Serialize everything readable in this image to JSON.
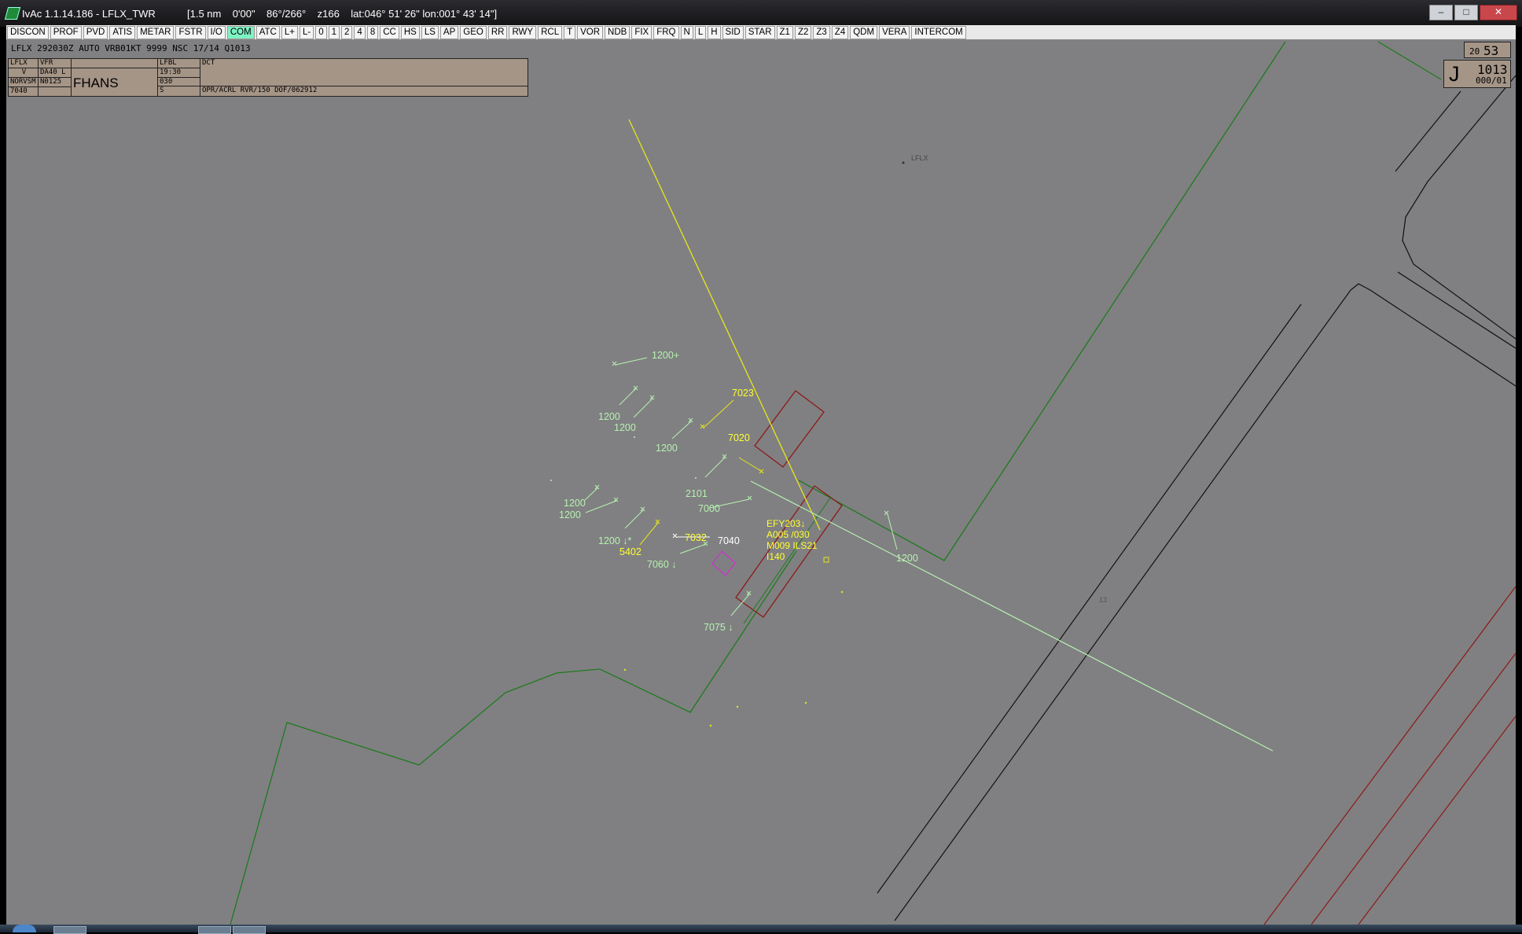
{
  "window": {
    "title": "IvAc 1.1.14.186  - LFLX_TWR",
    "info": "[1.5 nm    0'00\"    86°/266°    z166    lat:046° 51' 26\" lon:001° 43' 14\"]",
    "btn_minimize": "–",
    "btn_maximize": "□",
    "btn_close": "✕"
  },
  "toolbar": {
    "items": [
      "DISCON",
      "PROF",
      "PVD",
      "ATIS",
      "METAR",
      "FSTR",
      "I/O",
      "COM",
      "ATC",
      "L+",
      "L-",
      "0",
      "1",
      "2",
      "4",
      "8",
      "CC",
      "HS",
      "LS",
      "AP",
      "GEO",
      "RR",
      "RWY",
      "RCL",
      "T",
      "VOR",
      "NDB",
      "FIX",
      "FRQ",
      "N",
      "L",
      "H",
      "SID",
      "STAR",
      "Z1",
      "Z2",
      "Z3",
      "Z4",
      "QDM",
      "VERA",
      "INTERCOM"
    ],
    "active": "COM"
  },
  "metar": "LFLX 292030Z AUTO VRB01KT 9999 NSC 17/14 Q1013",
  "strip": {
    "dep": "LFLX",
    "rules": "VFR",
    "type": "DA40 L",
    "flight_rules_code": "V",
    "route_point": "NORVSM",
    "speed": "N0125",
    "squawk": "7040",
    "callsign": "FHANS",
    "dest": "LFBL",
    "time": "19:30",
    "level": "030",
    "s_field": "S",
    "route": "DCT",
    "remarks": "OPR/ACRL RVR/150 DOF/062912"
  },
  "clock": {
    "hour": "20",
    "minute": "53"
  },
  "qnh": {
    "letter": "J",
    "value": "1013",
    "wind": "000/01"
  },
  "radar": {
    "airport_label": "LFLX",
    "runway_label": "13",
    "targets_green": [
      "1200+",
      "1200",
      "1200",
      "1200",
      "2101",
      "1200",
      "1200",
      "1200 ↓*",
      "7000",
      "7060 ↓",
      "1200",
      "7075 ↓"
    ],
    "targets_yellow": [
      "7023",
      "7020",
      "5402",
      "7032"
    ],
    "target_white": "7040",
    "tag": {
      "line1": "EFY203↓",
      "line2": "A005 /030",
      "line3": "M009 ILS21",
      "line4": "I140"
    }
  },
  "colors": {
    "radar_bg": "#808082",
    "sector_line": "#1f7a1f",
    "target_green": "#b6f2b0",
    "target_yellow": "#ffff33",
    "runway_box": "#8b1a1a",
    "strip_bg": "#a59587"
  }
}
